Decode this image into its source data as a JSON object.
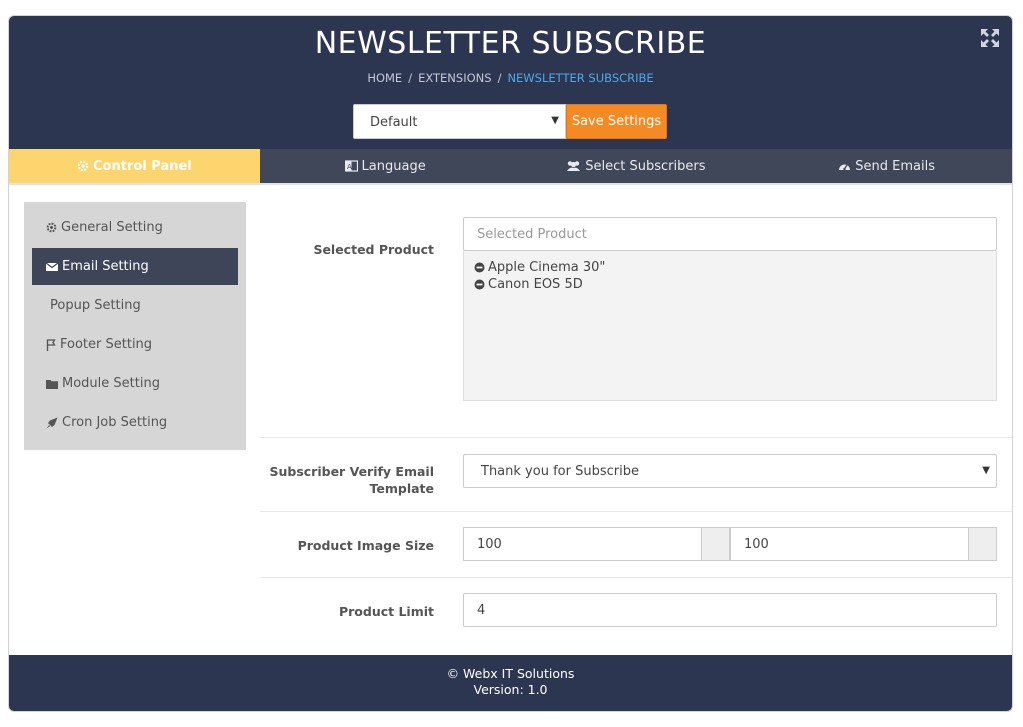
{
  "header": {
    "title": "NEWSLETTER SUBSCRIBE",
    "breadcrumb": [
      "HOME",
      "EXTENSIONS",
      "NEWSLETTER SUBSCRIBE"
    ],
    "store_select_value": "Default",
    "save_label": "Save Settings"
  },
  "tabs": [
    {
      "label": "Control Panel",
      "icon": "gear-icon"
    },
    {
      "label": "Language",
      "icon": "language-icon"
    },
    {
      "label": "Select Subscribers",
      "icon": "users-icon"
    },
    {
      "label": "Send Emails",
      "icon": "dashboard-icon"
    }
  ],
  "sidebar": {
    "items": [
      {
        "label": "General Setting",
        "icon": "gear-icon"
      },
      {
        "label": "Email Setting",
        "icon": "envelope-icon"
      },
      {
        "label": "Popup Setting",
        "icon": ""
      },
      {
        "label": "Footer Setting",
        "icon": "flag-icon"
      },
      {
        "label": "Module Setting",
        "icon": "folder-icon"
      },
      {
        "label": "Cron Job Setting",
        "icon": "rocket-icon"
      }
    ]
  },
  "form": {
    "selected_product": {
      "label": "Selected Product",
      "placeholder": "Selected Product",
      "items": [
        "Apple Cinema 30\"",
        "Canon EOS 5D"
      ]
    },
    "verify_template": {
      "label_line1": "Subscriber Verify Email",
      "label_line2": "Template",
      "value": "Thank you for Subscribe"
    },
    "image_size": {
      "label": "Product Image Size",
      "width": "100",
      "height": "100"
    },
    "product_limit": {
      "label": "Product Limit",
      "value": "4"
    }
  },
  "footer": {
    "line1": "© Webx IT Solutions",
    "line2": "Version: 1.0"
  },
  "colors": {
    "header_bg": "#2d3650",
    "accent_orange": "#f58a25",
    "active_tab": "#fdd56e",
    "breadcrumb_active": "#4fa8e8"
  }
}
